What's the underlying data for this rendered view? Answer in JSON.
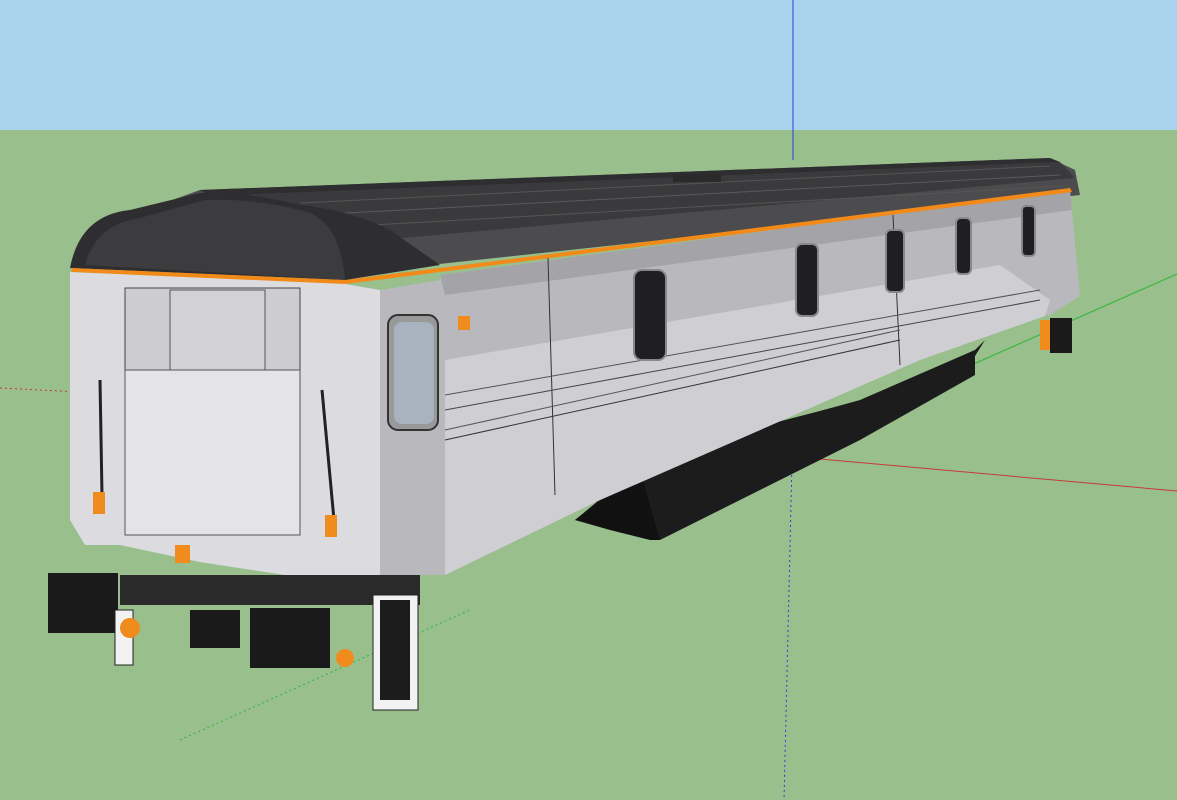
{
  "viewport": {
    "sky_color": "#a9d3ec",
    "sky_top_color": "#b6dcef",
    "ground_color": "#99bf8c",
    "axis_blue_color": "#2a3fd6",
    "axis_red_color": "#c83a3a",
    "axis_green_color": "#2fb53a"
  },
  "model": {
    "body_light_color": "#dcdce0",
    "body_mid_color": "#b9b9bd",
    "body_shade_color": "#8f8f93",
    "roof_color": "#4c4c4e",
    "roof_dark_color": "#2e2e30",
    "stripe_color": "#f28a1a",
    "window_color": "#1f1f21",
    "window_glass_color": "#a9b3bf",
    "underframe_color": "#1c1c1d",
    "buffer_color": "#1a1a1a",
    "fitting_color": "#f08c1e"
  }
}
